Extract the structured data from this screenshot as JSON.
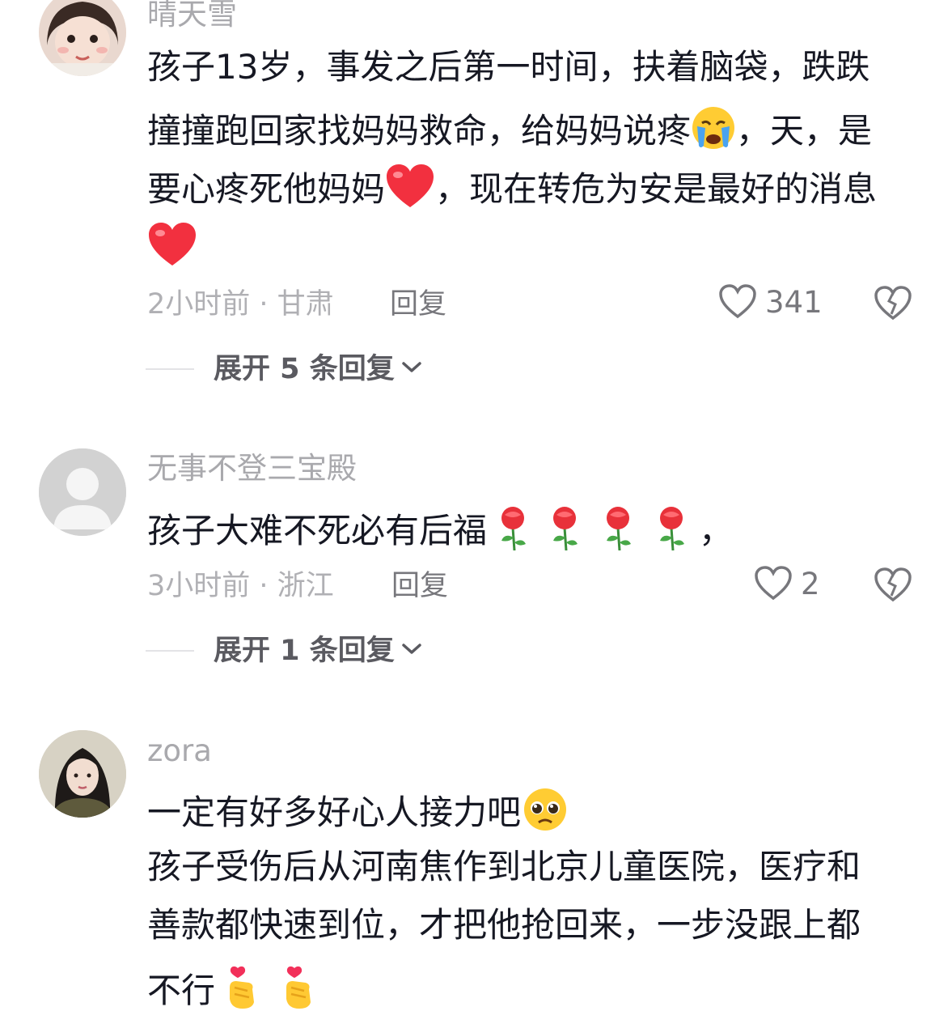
{
  "comments": [
    {
      "username": "晴天雪",
      "lines": [
        "孩子13岁，事发之后第一时间，扶着脑袋，跌跌",
        "撞撞跑回家找妈妈救命，给妈妈说疼",
        "，天，是",
        "要心疼死他妈妈",
        "，现在转危为安是最好的消息"
      ],
      "time_location": "2小时前 · 甘肃",
      "reply_label": "回复",
      "likes": "341",
      "expand_label": "展开 5 条回复"
    },
    {
      "username": "无事不登三宝殿",
      "lines": [
        "孩子大难不死必有后福",
        "，"
      ],
      "time_location": "3小时前 · 浙江",
      "reply_label": "回复",
      "likes": "2",
      "expand_label": "展开 1 条回复"
    },
    {
      "username": "zora",
      "lines": [
        "一定有好多好心人接力吧",
        "孩子受伤后从河南焦作到北京儿童医院，医疗和",
        "善款都快速到位，才把他抢回来，一步没跟上都",
        "不行"
      ]
    }
  ],
  "icons": {
    "like": "heart-outline-icon",
    "dislike": "broken-heart-icon",
    "expand": "chevron-down-icon"
  },
  "colors": {
    "text": "#161823",
    "muted": "#b0b0b4",
    "heart_red": "#f2303f"
  }
}
